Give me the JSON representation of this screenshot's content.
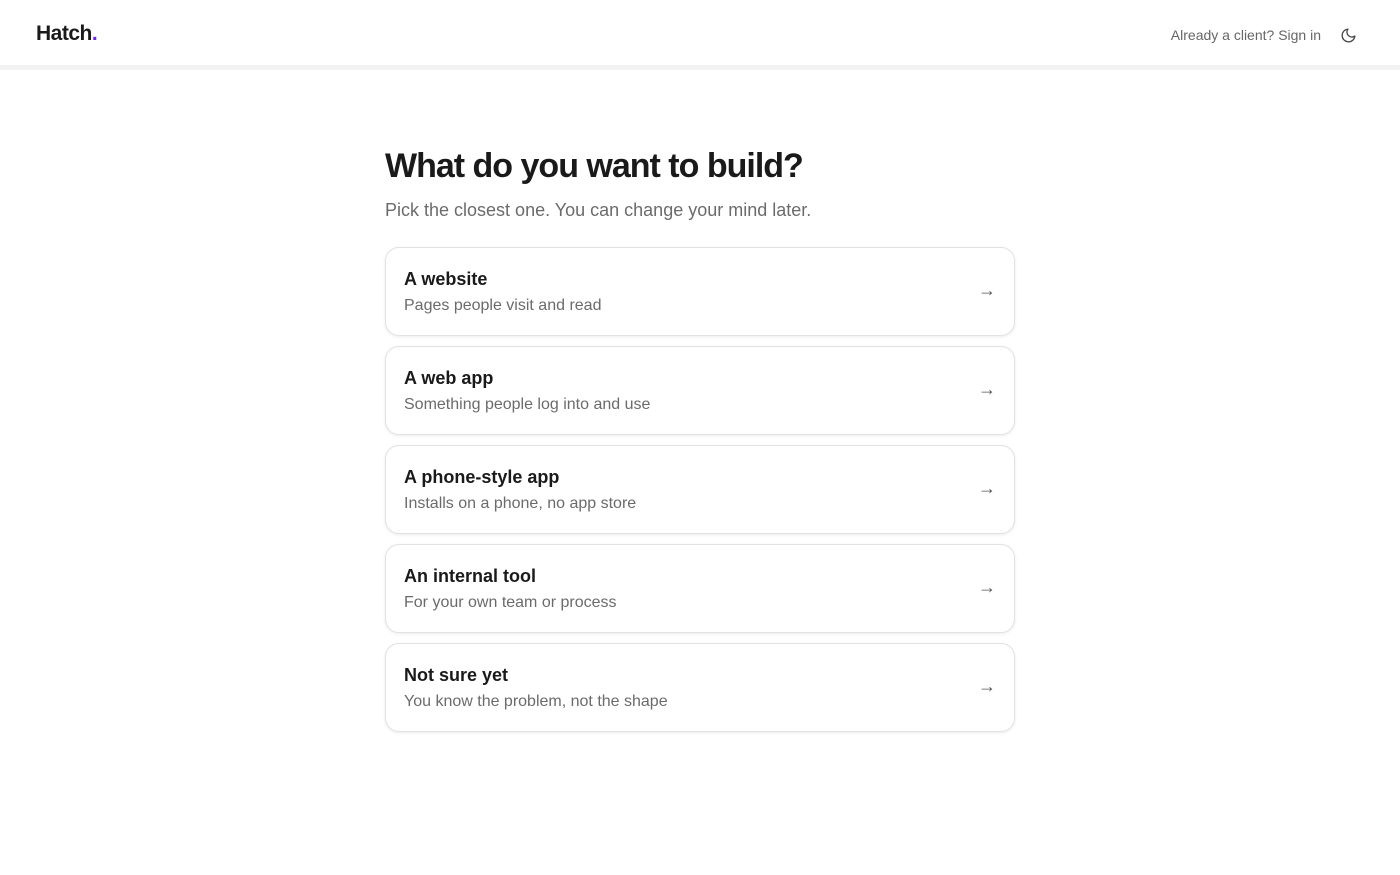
{
  "header": {
    "logo_text": "Hatch",
    "logo_dot": ".",
    "signin_label": "Already a client? Sign in",
    "theme_icon": "moon-icon"
  },
  "main": {
    "title": "What do you want to build?",
    "subtitle": "Pick the closest one. You can change your mind later.",
    "options": [
      {
        "title": "A website",
        "description": "Pages people visit and read",
        "arrow": "→"
      },
      {
        "title": "A web app",
        "description": "Something people log into and use",
        "arrow": "→"
      },
      {
        "title": "A phone-style app",
        "description": "Installs on a phone, no app store",
        "arrow": "→"
      },
      {
        "title": "An internal tool",
        "description": "For your own team or process",
        "arrow": "→"
      },
      {
        "title": "Not sure yet",
        "description": "You know the problem, not the shape",
        "arrow": "→"
      }
    ]
  },
  "colors": {
    "accent": "#6d28d9",
    "text": "#1a1a1a",
    "muted": "#6b6b6b",
    "border": "#e2e2e2"
  }
}
